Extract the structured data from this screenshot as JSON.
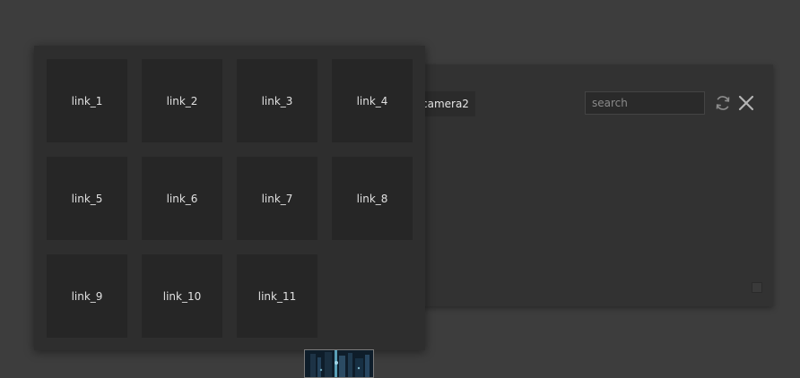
{
  "panel": {
    "camera_tab_label": "camera2",
    "search": {
      "placeholder": "search",
      "value": ""
    },
    "icons": {
      "refresh": "refresh-icon",
      "close": "close-icon"
    }
  },
  "link_menu": {
    "items": [
      {
        "label": "link_1"
      },
      {
        "label": "link_2"
      },
      {
        "label": "link_3"
      },
      {
        "label": "link_4"
      },
      {
        "label": "link_5"
      },
      {
        "label": "link_6"
      },
      {
        "label": "link_7"
      },
      {
        "label": "link_8"
      },
      {
        "label": "link_9"
      },
      {
        "label": "link_10"
      },
      {
        "label": "link_11"
      }
    ]
  },
  "colors": {
    "background": "#3d3d3d",
    "panel": "#323232",
    "overlay": "#2e2e2e",
    "tile": "#262626",
    "text": "#e0e0e0"
  }
}
